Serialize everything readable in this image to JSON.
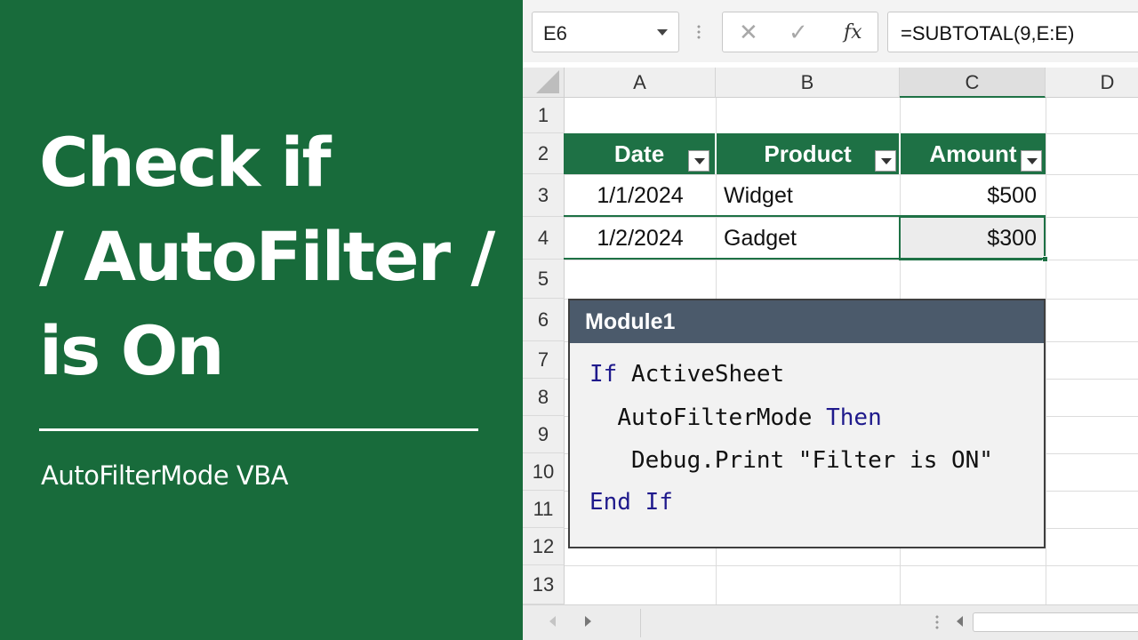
{
  "hero": {
    "title_lines": [
      "Check if",
      "/ AutoFilter /",
      "is On"
    ],
    "subtitle": "AutoFilterMode VBA"
  },
  "formula_bar": {
    "name_box": "E6",
    "cancel_icon": "✕",
    "enter_icon": "✓",
    "fx_icon": "fx",
    "formula": "=SUBTOTAL(9,E:E)"
  },
  "columns": [
    "A",
    "B",
    "C",
    "D"
  ],
  "rows": [
    "1",
    "2",
    "3",
    "4",
    "5",
    "6",
    "7",
    "8",
    "9",
    "10",
    "11",
    "12",
    "13"
  ],
  "table": {
    "headers": [
      "Date",
      "Product",
      "Amount"
    ],
    "rows": [
      [
        "1/1/2024",
        "Widget",
        "$500"
      ],
      [
        "1/2/2024",
        "Gadget",
        "$300"
      ]
    ]
  },
  "vba_window": {
    "title": "Module1",
    "code": [
      {
        "keyword": "If",
        "text": " ActiveSheet"
      },
      {
        "pre": "  ",
        "text": "AutoFilterMode ",
        "keyword": "Then"
      },
      {
        "pre": "   ",
        "text": "Debug.Print \"Filter is ON\""
      },
      {
        "keyword": "End If",
        "text": ""
      }
    ]
  },
  "colors": {
    "panel_green": "#186b3b",
    "excel_green": "#1e7145",
    "vba_title_bar": "#4b5a6b",
    "vba_keyword": "#1f1a8c"
  }
}
